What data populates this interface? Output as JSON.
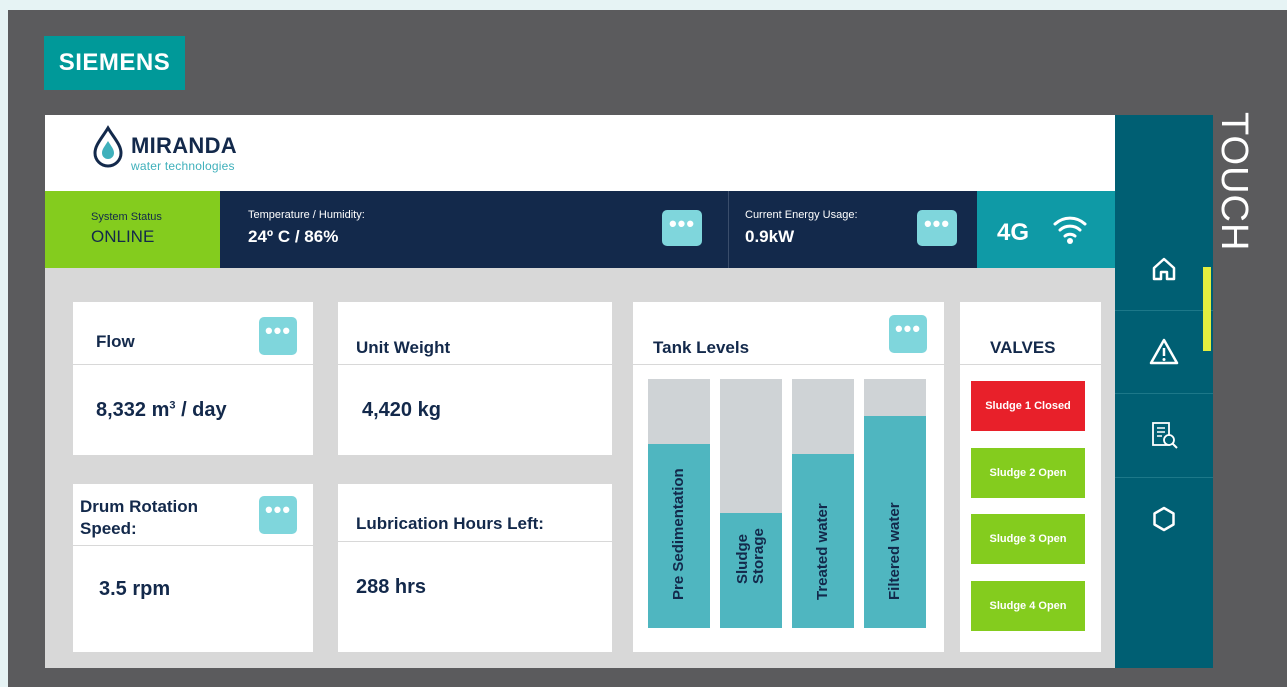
{
  "device": {
    "brand": "SIEMENS",
    "panel_label": "TOUCH"
  },
  "brand": {
    "name": "MIRANDA",
    "tagline": "water technologies"
  },
  "status": {
    "system_label": "System Status",
    "system_value": "ONLINE",
    "temp_label": "Temperature / Humidity:",
    "temp_value": "24º C / 86%",
    "energy_label": "Current Energy Usage:",
    "energy_value": "0.9kW",
    "network": "4G"
  },
  "more_label": "•••",
  "cards": {
    "flow": {
      "title": "Flow",
      "value": "8,332 m",
      "sup": "3",
      "unit": " / day"
    },
    "unit_weight": {
      "title": "Unit Weight",
      "value": "4,420 kg"
    },
    "drum": {
      "title_line1": "Drum Rotation",
      "title_line2": "Speed:",
      "value": "3.5 rpm"
    },
    "lube": {
      "title": "Lubrication Hours Left:",
      "value": "288 hrs"
    }
  },
  "tanks": {
    "title": "Tank Levels",
    "items": [
      {
        "label_line1": "Pre Sedimentation",
        "label_line2": "",
        "level_pct": 74
      },
      {
        "label_line1": "Sludge",
        "label_line2": "Storage",
        "level_pct": 46
      },
      {
        "label_line1": "Treated water",
        "label_line2": "",
        "level_pct": 70
      },
      {
        "label_line1": "Filtered water",
        "label_line2": "",
        "level_pct": 85
      }
    ]
  },
  "valves": {
    "title": "VALVES",
    "items": [
      {
        "label": "Sludge 1 Closed",
        "state": "closed"
      },
      {
        "label": "Sludge 2 Open",
        "state": "open"
      },
      {
        "label": "Sludge 3 Open",
        "state": "open"
      },
      {
        "label": "Sludge 4 Open",
        "state": "open"
      }
    ]
  },
  "nav": [
    {
      "icon": "home-icon"
    },
    {
      "icon": "alert-icon"
    },
    {
      "icon": "report-search-icon"
    },
    {
      "icon": "settings-icon"
    }
  ],
  "colors": {
    "navy": "#13294b",
    "green": "#84cc1e",
    "teal": "#0f9aa6",
    "tank_fill": "#4fb6c0",
    "valve_closed": "#e8202a",
    "valve_open": "#84cc1e",
    "siemens": "#009999",
    "sidebar": "#005f73",
    "scroll_indicator": "#e4ef3f"
  }
}
